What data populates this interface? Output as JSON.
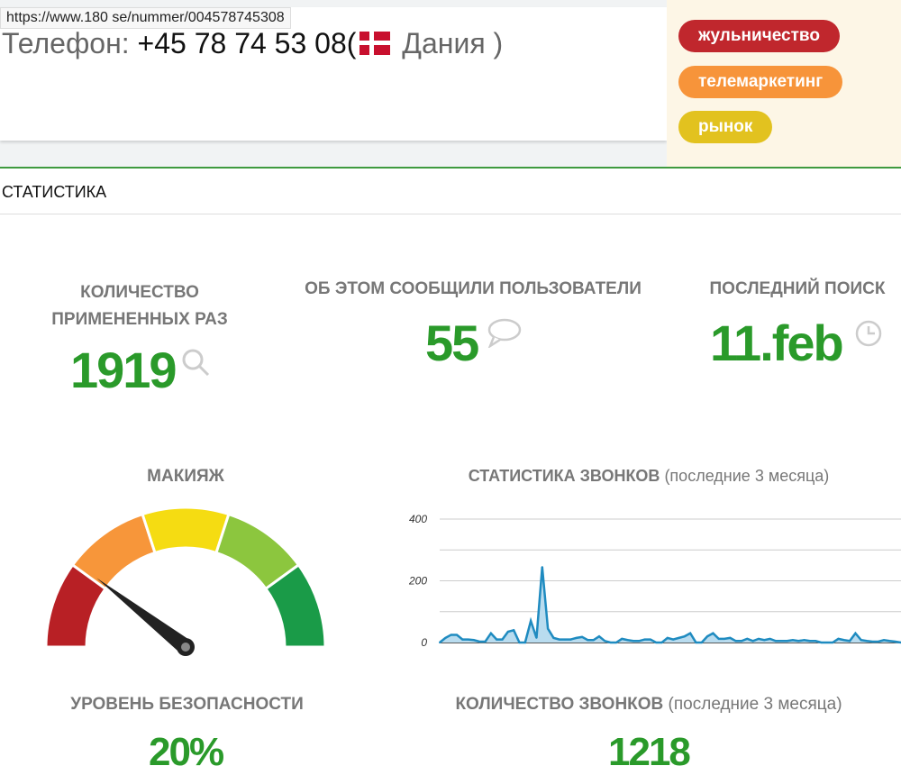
{
  "url_tooltip": "https://www.180 se/nummer/004578745308",
  "phone": {
    "label": "Телефон: ",
    "number": "+45 78 74 53 08",
    "open": "(",
    "country": " Дания )"
  },
  "tags": [
    {
      "label": "жульничество",
      "color": "#c0272d"
    },
    {
      "label": "телемаркетинг",
      "color": "#f7943a"
    },
    {
      "label": "рынок",
      "color": "#e2c21f"
    }
  ],
  "section_title": "СТАТИСТИКА",
  "stats": {
    "used": {
      "label1": "КОЛИЧЕСТВО",
      "label2": "ПРИМЕНЕННЫХ РАЗ",
      "value": "1919",
      "icon": "search-icon"
    },
    "reported": {
      "label": "ОБ ЭТОМ СООБЩИЛИ ПОЛЬЗОВАТЕЛИ",
      "value": "55",
      "icon": "comment-icon"
    },
    "last": {
      "label": "ПОСЛЕДНИЙ ПОИСК",
      "value": "11.feb",
      "icon": "clock-icon"
    }
  },
  "gauge": {
    "title": "МАКИЯЖ",
    "value_percent": 20,
    "colors": [
      "#b82025",
      "#f7963a",
      "#f5dc12",
      "#8cc63e",
      "#1a9b48"
    ]
  },
  "safety": {
    "label": "УРОВЕНЬ БЕЗОПАСНОСТИ",
    "value": "20%"
  },
  "calls": {
    "label": "КОЛИЧЕСТВО ЗВОНКОВ",
    "label_suffix": " (последние 3 месяца)",
    "value": "1218"
  },
  "chart_data": {
    "type": "area",
    "title": "СТАТИСТИКА ЗВОНКОВ",
    "title_suffix": " (последние 3 месяца)",
    "ylim": [
      0,
      400
    ],
    "yticks": [
      "400",
      "200",
      "0"
    ],
    "grid": true,
    "values": [
      0,
      15,
      25,
      25,
      10,
      10,
      8,
      3,
      3,
      30,
      10,
      10,
      35,
      40,
      0,
      0,
      70,
      15,
      245,
      45,
      15,
      10,
      10,
      10,
      15,
      18,
      8,
      8,
      20,
      5,
      0,
      0,
      12,
      8,
      5,
      5,
      10,
      10,
      0,
      0,
      15,
      10,
      15,
      20,
      30,
      0,
      0,
      20,
      30,
      12,
      12,
      15,
      5,
      5,
      12,
      5,
      12,
      8,
      12,
      5,
      5,
      5,
      8,
      5,
      8,
      5,
      5,
      0,
      0,
      0,
      12,
      8,
      5,
      30,
      8,
      5,
      3,
      3,
      8,
      5,
      3,
      0
    ]
  }
}
